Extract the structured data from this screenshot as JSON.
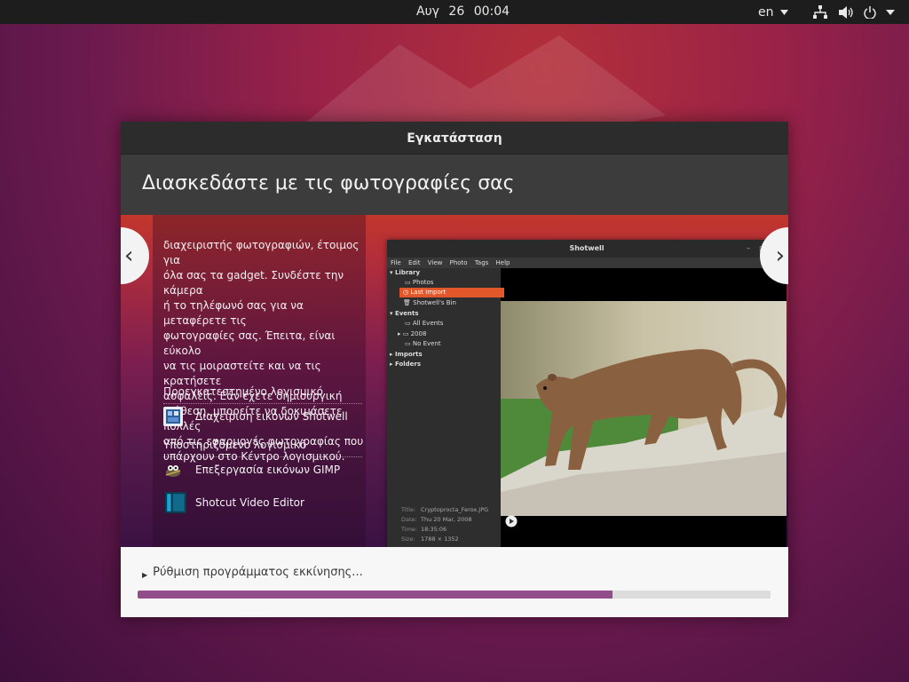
{
  "topbar": {
    "date": "Αυγ 26",
    "time": "00:04",
    "language": "en"
  },
  "window": {
    "title": "Εγκατάσταση",
    "heading": "Διασκεδάστε με τις φωτογραφίες σας"
  },
  "slide": {
    "description_lines": [
      "διαχειριστής φωτογραφιών, έτοιμος για",
      "όλα σας τα gadget. Συνδέστε την κάμερα",
      "ή το τηλέφωνό σας για να μεταφέρετε τις",
      "φωτογραφίες σας. Έπειτα, είναι εύκολο",
      "να τις μοιραστείτε και να τις κρατήσετε",
      "ασφαλείς. Εάν έχετε δημιουργική",
      "διάθεση, μπορείτε να δοκιμάσετε πολλές",
      "από τις εφαρμογές φωτογραφίας που",
      "υπάρχουν στο Κέντρο λογισμικού."
    ],
    "preinstalled_label": "Προεγκατεστημένο λογισμικό",
    "preinstalled_apps": [
      {
        "name": "Διαχείριση εικόνων Shotwell",
        "icon": "shotwell-icon"
      }
    ],
    "supported_label": "Υποστηριζόμενο λογισμικό",
    "supported_apps": [
      {
        "name": "Επεξεργασία εικόνων GIMP",
        "icon": "gimp-icon"
      },
      {
        "name": "Shotcut Video Editor",
        "icon": "shotcut-icon"
      }
    ],
    "prev_glyph": "‹",
    "next_glyph": "›"
  },
  "shotwell": {
    "title": "Shotwell",
    "menu": [
      "File",
      "Edit",
      "View",
      "Photo",
      "Tags",
      "Help"
    ],
    "sidebar": {
      "library": "Library",
      "photos": "Photos",
      "last_import": "Last Import",
      "bin": "Shotwell's Bin",
      "events": "Events",
      "all_events": "All Events",
      "year": "2008",
      "no_event": "No Event",
      "imports": "Imports",
      "folders": "Folders"
    },
    "meta": {
      "title_label": "Title:",
      "title_value": "Cryptoprocta_Ferox.JPG",
      "date_label": "Date:",
      "date_value": "Thu 20 Mar, 2008",
      "time_label": "Time:",
      "time_value": "18:35:06",
      "size_label": "Size:",
      "size_value": "1788 × 1352"
    }
  },
  "footer": {
    "status": "Ρύθμιση προγράμματος εκκίνησης...",
    "progress": 0.75
  },
  "colors": {
    "progress_fill": "#924d8b",
    "highlight": "#e2572a"
  }
}
